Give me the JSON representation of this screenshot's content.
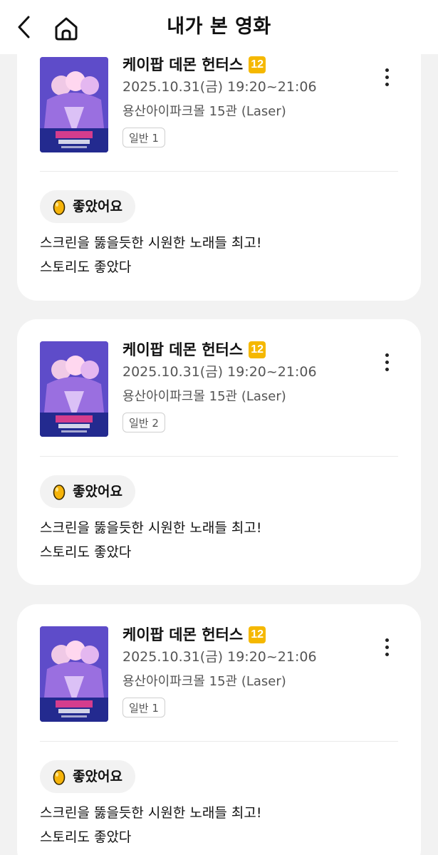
{
  "header": {
    "title": "내가 본 영화",
    "back_icon": "chevron-left-icon",
    "home_icon": "home-icon"
  },
  "cards": [
    {
      "movie_title": "케이팝 데몬 헌터스",
      "rating": "12",
      "datetime": "2025.10.31(금) 19:20~21:06",
      "theater": "용산아이파크몰 15관 (Laser)",
      "ticket_type": "일반 1",
      "reaction": "좋았어요",
      "review_line1": "스크린을 뚫을듯한 시원한 노래들 최고!",
      "review_line2": "스토리도 좋았다"
    },
    {
      "movie_title": "케이팝 데몬 헌터스",
      "rating": "12",
      "datetime": "2025.10.31(금) 19:20~21:06",
      "theater": "용산아이파크몰 15관 (Laser)",
      "ticket_type": "일반 2",
      "reaction": "좋았어요",
      "review_line1": "스크린을 뚫을듯한 시원한 노래들 최고!",
      "review_line2": "스토리도 좋았다"
    },
    {
      "movie_title": "케이팝 데몬 헌터스",
      "rating": "12",
      "datetime": "2025.10.31(금) 19:20~21:06",
      "theater": "용산아이파크몰 15관 (Laser)",
      "ticket_type": "일반 1",
      "reaction": "좋았어요",
      "review_line1": "스크린을 뚫을듯한 시원한 노래들 최고!",
      "review_line2": "스토리도 좋았다"
    }
  ],
  "colors": {
    "rating_badge": "#f5b800",
    "background": "#f2f2f2",
    "card": "#ffffff"
  }
}
